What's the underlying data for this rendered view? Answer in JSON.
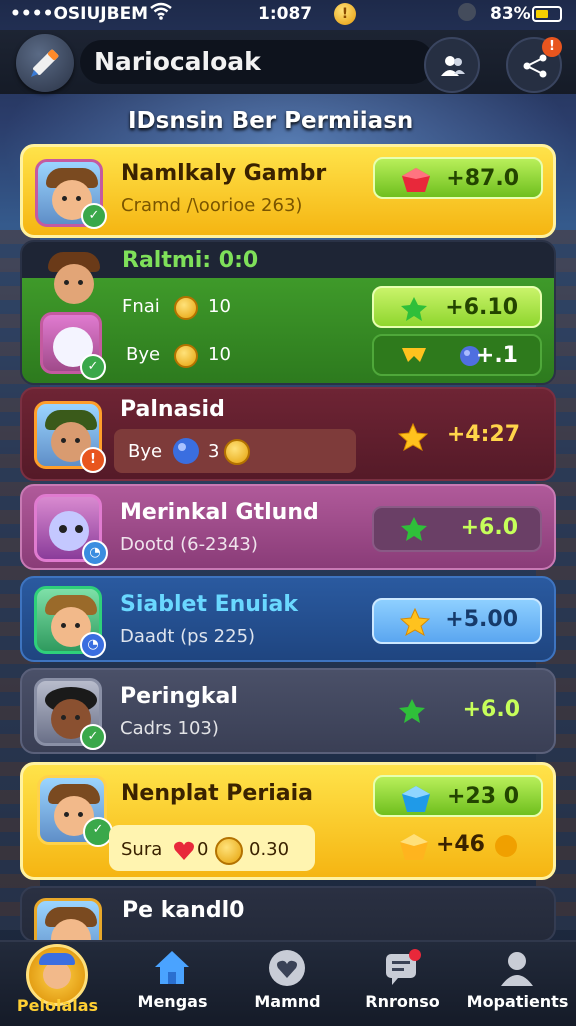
{
  "status_bar": {
    "carrier": "••••OSIUJBEM",
    "time": "1:087",
    "battery": "83%"
  },
  "header": {
    "title": "Nariocaloak",
    "notification_badge": "!"
  },
  "section_title": "IDsnsin Ber Permiiasn",
  "rows": [
    {
      "name": "Namlkaly Gambr",
      "sub": "Cramd /\\oorioe 263)",
      "reward": "+87.0",
      "gem": "red-gem"
    },
    {
      "header": "Raltmi: 0:0",
      "line1_label": "Fnai",
      "line1_value": "10",
      "line2_label": "Bye",
      "line2_value": "10",
      "reward1": "+6.10",
      "reward2": "+.1"
    },
    {
      "name": "Palnasid",
      "sub_label": "Bye",
      "sub_value": "3",
      "reward": "+4:27"
    },
    {
      "name": "Merinkal Gtlund",
      "sub": "Dootd (6-2343)",
      "reward": "+6.0"
    },
    {
      "name": "Siablet Enuiak",
      "sub": "Daadt (ps 225)",
      "reward": "+5.00"
    },
    {
      "name": "Peringkal",
      "sub": "Cadrs 103)",
      "reward": "+6.0"
    },
    {
      "name": "Nenplat Periaia",
      "sub_label": "Sura",
      "sub_value1": "0",
      "sub_value2": "0.30",
      "reward1": "+23 0",
      "reward2": "+46"
    },
    {
      "name": "Pe kandl0"
    }
  ],
  "bottom_nav": [
    {
      "label": "Pelolalas",
      "icon": "hero-avatar-icon",
      "active": true
    },
    {
      "label": "Mengas",
      "icon": "home-icon",
      "active": false
    },
    {
      "label": "Mamnd",
      "icon": "heart-chat-icon",
      "active": false
    },
    {
      "label": "Rnronso",
      "icon": "chat-icon",
      "active": false
    },
    {
      "label": "Mopatients",
      "icon": "profile-icon",
      "active": false
    }
  ],
  "colors": {
    "gold": "#ffcf33",
    "green": "#8ed32a",
    "blue": "#3a7bd5",
    "maroon": "#6a2330",
    "magenta": "#a04a8a"
  }
}
